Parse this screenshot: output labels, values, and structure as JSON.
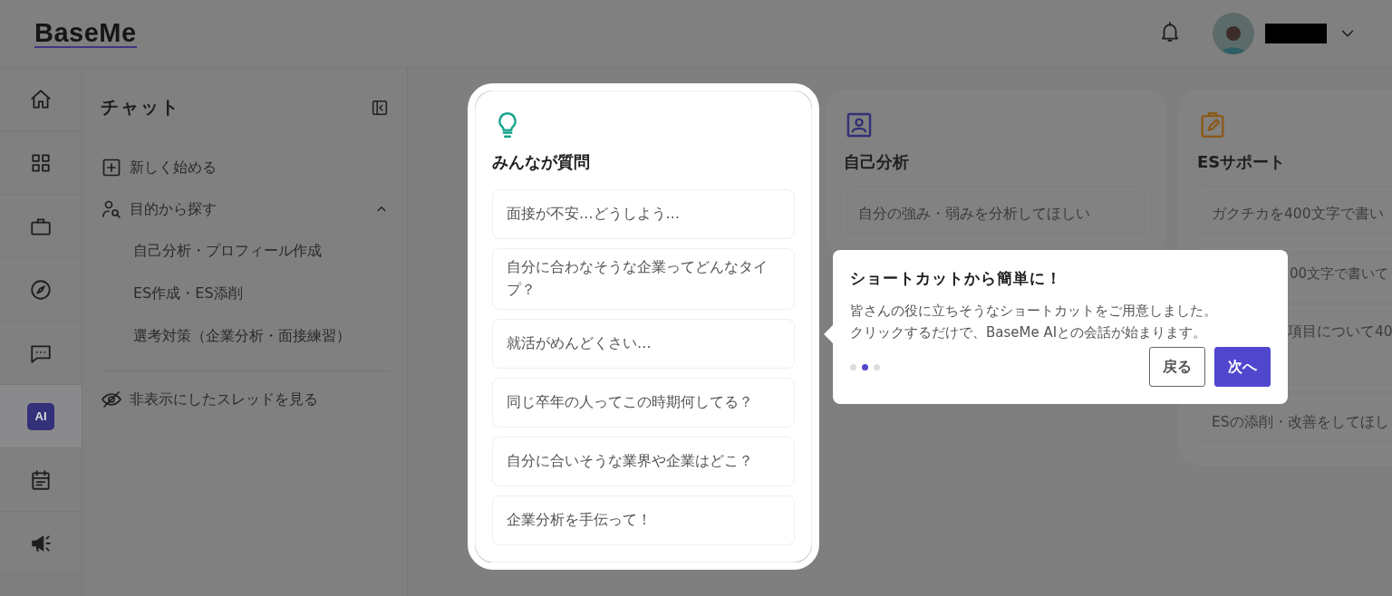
{
  "header": {
    "logo": "BaseMe"
  },
  "rail": [
    {
      "kind": "home",
      "selected": false
    },
    {
      "kind": "grid",
      "selected": false
    },
    {
      "kind": "briefcase",
      "selected": false
    },
    {
      "kind": "compass",
      "selected": false
    },
    {
      "kind": "chat",
      "selected": false
    },
    {
      "kind": "ai",
      "label": "AI",
      "selected": true
    },
    {
      "kind": "notes",
      "selected": false
    },
    {
      "kind": "megaphone",
      "selected": false
    }
  ],
  "chat_panel": {
    "title": "チャット",
    "new_chat": "新しく始める",
    "purpose": {
      "label": "目的から探す",
      "expanded": true,
      "children": [
        {
          "label": "自己分析・プロフィール作成"
        },
        {
          "label": "ES作成・ES添削"
        },
        {
          "label": "選考対策（企業分析・面接練習）"
        }
      ]
    },
    "hidden_threads": "非表示にしたスレッドを見る"
  },
  "cards": [
    {
      "kind": "bulb",
      "title": "みんなが質問",
      "highlighted": true,
      "items": [
        {
          "text": "面接が不安…どうしよう…",
          "kind": "full"
        },
        {
          "text": "自分に合わなそうな企業ってどんなタイプ？",
          "kind": "full"
        },
        {
          "text": "就活がめんどくさい…",
          "kind": "full"
        },
        {
          "text": "同じ卒年の人ってこの時期何してる？",
          "kind": "full"
        },
        {
          "text": "自分に合いそうな業界や企業はどこ？",
          "kind": "full"
        },
        {
          "text": "企業分析を手伝って！",
          "kind": "full"
        }
      ]
    },
    {
      "kind": "profile",
      "title": "自己分析",
      "highlighted": false,
      "items": [
        {
          "text": "自分の強み・弱みを分析してほしい",
          "kind": "full"
        }
      ]
    },
    {
      "kind": "clipboard",
      "title": "ESサポート",
      "highlighted": false,
      "items": [
        {
          "text": "ガクチカを400文字で書い",
          "kind": "full"
        },
        {
          "text": "00文字で書いて",
          "kind": "covered"
        },
        {
          "text": "項目について40",
          "kind": "covered-tall"
        },
        {
          "text": "ESの添削・改善をしてほし",
          "kind": "full"
        }
      ]
    }
  ],
  "tooltip": {
    "title": "ショートカットから簡単に！",
    "body_lines": [
      "皆さんの役に立ちそうなショートカットをご用意しました。",
      "クリックするだけで、BaseMe AIとの会話が始まります。"
    ],
    "steps": [
      {
        "selected": false
      },
      {
        "selected": true
      },
      {
        "selected": false
      }
    ],
    "back": "戻る",
    "next": "次へ"
  }
}
